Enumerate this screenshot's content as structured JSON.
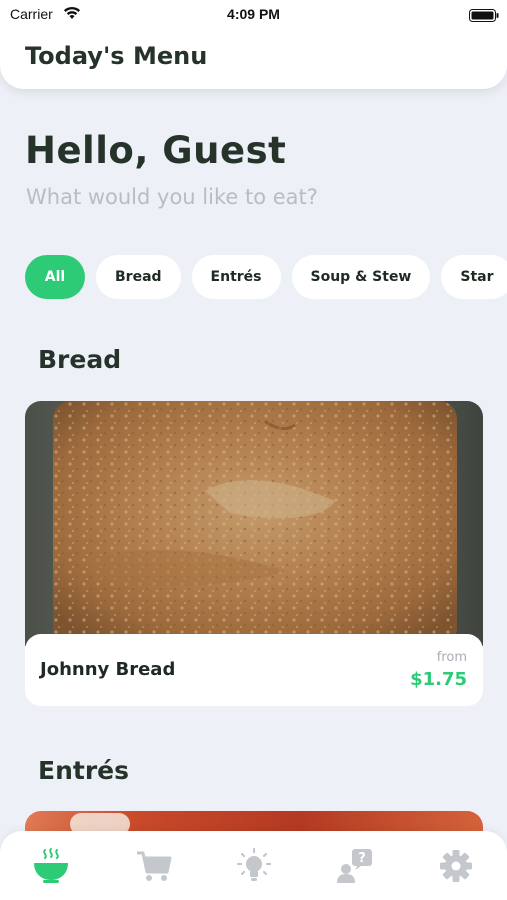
{
  "status_bar": {
    "carrier": "Carrier",
    "time": "4:09 PM"
  },
  "header": {
    "title": "Today's Menu"
  },
  "greeting": {
    "title": "Hello, Guest",
    "subtitle": "What would you like to eat?"
  },
  "categories": [
    {
      "label": "All",
      "active": true
    },
    {
      "label": "Bread"
    },
    {
      "label": "Entrés"
    },
    {
      "label": "Soup & Stew"
    },
    {
      "label": "Star"
    }
  ],
  "sections": [
    {
      "title": "Bread",
      "items": [
        {
          "name": "Johnny Bread",
          "from_label": "from",
          "price": "$1.75"
        }
      ]
    },
    {
      "title": "Entrés"
    }
  ],
  "tab_bar": [
    {
      "icon": "food-bowl-icon",
      "active": true,
      "color": "#2ecb77"
    },
    {
      "icon": "cart-icon"
    },
    {
      "icon": "lightbulb-icon"
    },
    {
      "icon": "help-person-icon"
    },
    {
      "icon": "gear-icon"
    }
  ],
  "colors": {
    "accent": "#2ecb77",
    "background": "#eef0f7",
    "inactive_icon": "#c4c7cc"
  }
}
